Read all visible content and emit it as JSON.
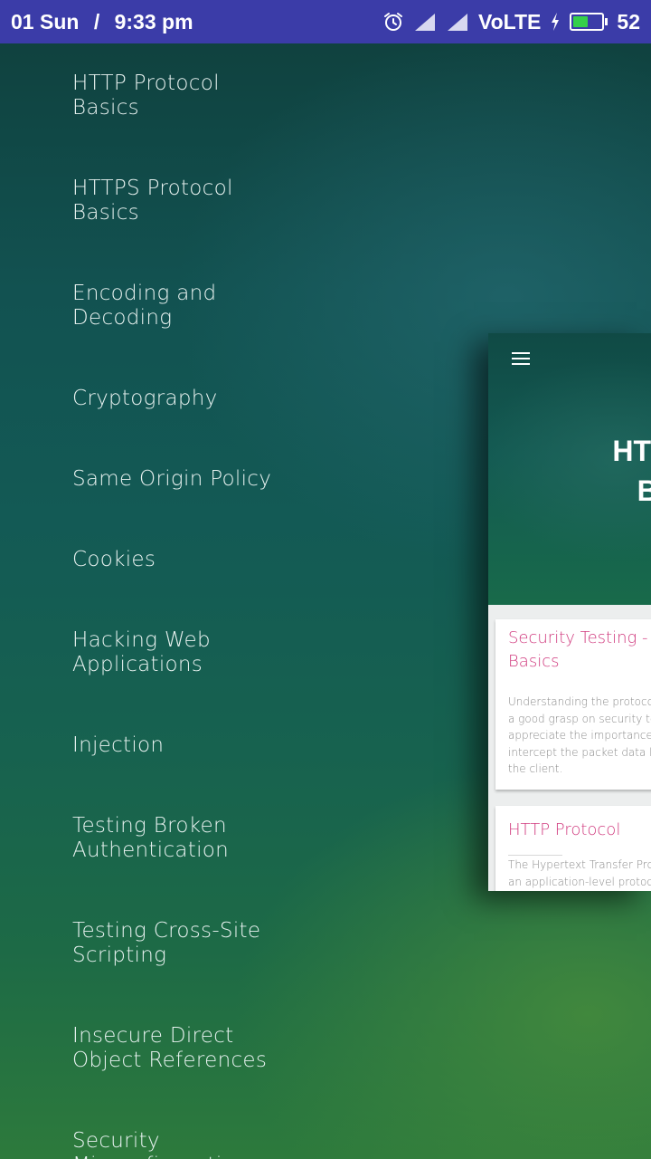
{
  "status_bar": {
    "date": "01 Sun",
    "separator": "/",
    "time": "9:33 pm",
    "network_label": "VoLTE",
    "battery_level": "52",
    "battery_fraction": 0.52,
    "icons": [
      "alarm-icon",
      "signal-icon",
      "signal-icon",
      "charging-icon",
      "battery-icon"
    ]
  },
  "drawer": {
    "items": [
      {
        "label": "HTTP Protocol\nBasics"
      },
      {
        "label": "HTTPS Protocol\nBasics"
      },
      {
        "label": "Encoding and\nDecoding"
      },
      {
        "label": "Cryptography"
      },
      {
        "label": "Same Origin Policy"
      },
      {
        "label": "Cookies"
      },
      {
        "label": "Hacking Web\nApplications"
      },
      {
        "label": "Injection"
      },
      {
        "label": "Testing Broken\nAuthentication"
      },
      {
        "label": "Testing Cross-Site\nScripting"
      },
      {
        "label": "Insecure Direct\nObject References"
      },
      {
        "label": "Security\nMisconfiguration"
      }
    ]
  },
  "preview": {
    "title": "HTTP P\nBas",
    "cards": [
      {
        "title": "Security Testing - H\nBasics",
        "body": "Understanding the protoco\na good grasp on security te\nappreciate the importance\nintercept the packet data b\nthe client."
      },
      {
        "title": "HTTP Protocol",
        "body": "The Hypertext Transfer Prot\nan application-level protoc"
      }
    ]
  },
  "colors": {
    "status_bar": "#3b3ca8",
    "card_title": "#d03a7e",
    "battery": "#35d04a"
  }
}
